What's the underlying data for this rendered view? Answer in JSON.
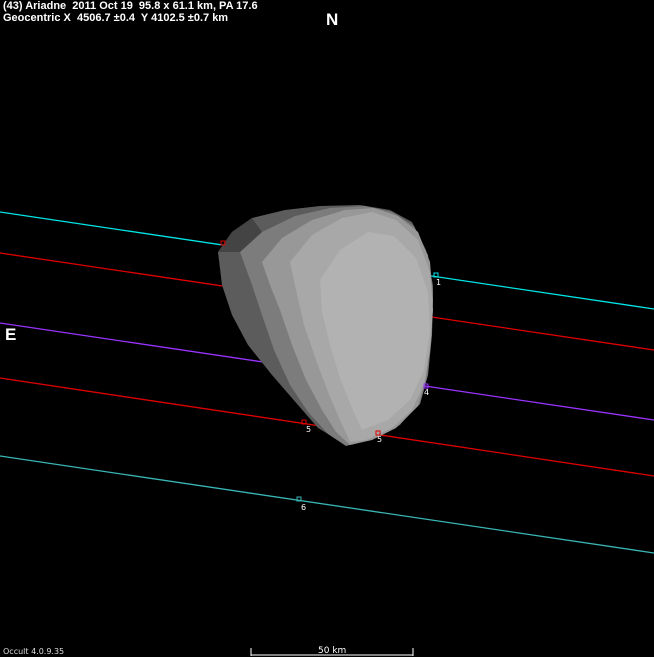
{
  "header": {
    "line1": "(43) Ariadne  2011 Oct 19  95.8 x 61.1 km, PA 17.6",
    "line2": "Geocentric X  4506.7 ±0.4  Y 4102.5 ±0.7 km"
  },
  "directions": {
    "north": "N",
    "east": "E"
  },
  "scale": {
    "label": "50 km"
  },
  "version": "Occult 4.0.9.35",
  "colors": {
    "cyan": "#00e5e5",
    "red": "#e00000",
    "purple": "#9933ff",
    "teal": "#3ab5b5",
    "body": "#a8a8a8"
  },
  "chords": [
    {
      "id": "1",
      "color": "cyan",
      "labels": [
        "1"
      ]
    },
    {
      "id": "2",
      "color": "red",
      "labels": []
    },
    {
      "id": "3",
      "color": "purple",
      "labels": [
        "4"
      ]
    },
    {
      "id": "4",
      "color": "red",
      "labels": [
        "5",
        "5"
      ]
    },
    {
      "id": "5",
      "color": "teal",
      "labels": [
        "6"
      ]
    }
  ]
}
